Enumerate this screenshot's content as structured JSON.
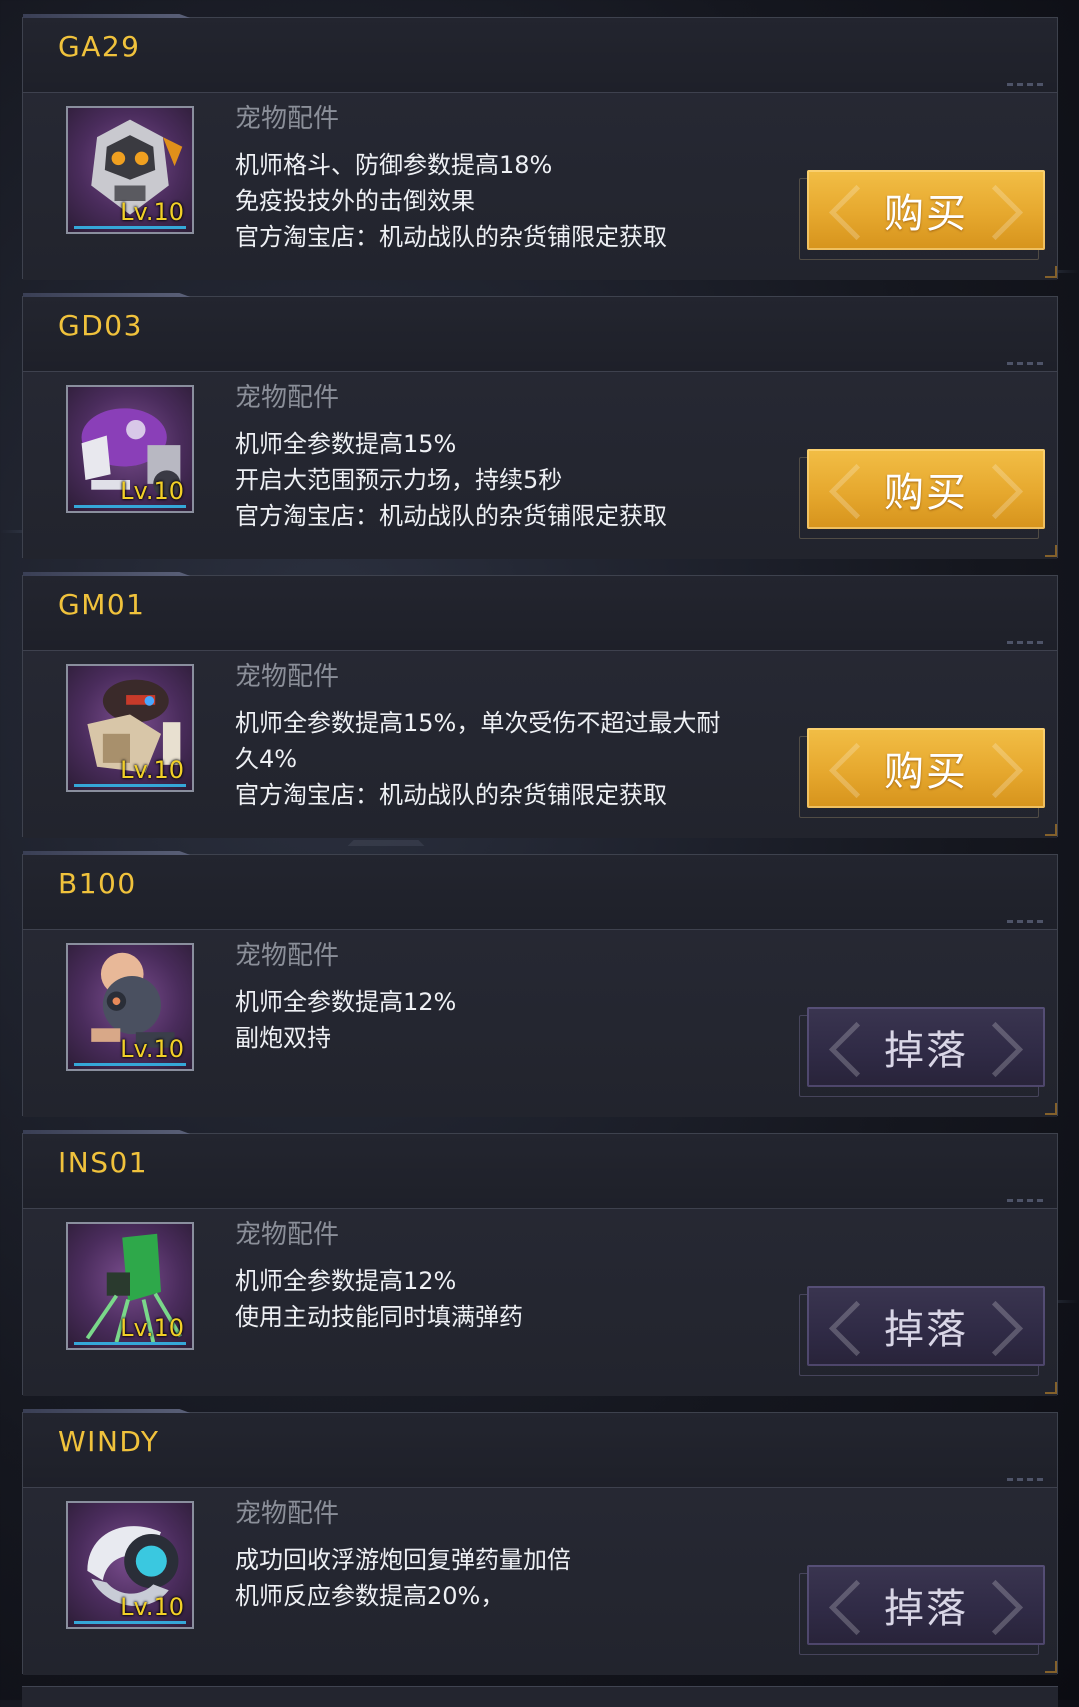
{
  "colors": {
    "code_text": "#f0c23c",
    "level_text": "#f2d028",
    "buy_button": "#e6a82e",
    "drop_button": "#2f2a45"
  },
  "items": [
    {
      "code": "GA29",
      "category": "宠物配件",
      "level": "Lv.10",
      "description": [
        "机师格斗、防御参数提高18%",
        "免疫投技外的击倒效果",
        "官方淘宝店：机动战队的杂货铺限定获取"
      ],
      "action": {
        "type": "buy",
        "label": "购买"
      },
      "icon": "gorilla-mech-icon"
    },
    {
      "code": "GD03",
      "category": "宠物配件",
      "level": "Lv.10",
      "description": [
        "机师全参数提高15%",
        "开启大范围预示力场，持续5秒",
        "官方淘宝店：机动战队的杂货铺限定获取"
      ],
      "action": {
        "type": "buy",
        "label": "购买"
      },
      "icon": "purple-dino-mech-icon"
    },
    {
      "code": "GM01",
      "category": "宠物配件",
      "level": "Lv.10",
      "description": [
        "机师全参数提高15%，单次受伤不超过最大耐",
        "久4%",
        "官方淘宝店：机动战队的杂货铺限定获取"
      ],
      "action": {
        "type": "buy",
        "label": "购买"
      },
      "icon": "monkey-mech-icon"
    },
    {
      "code": "B100",
      "category": "宠物配件",
      "level": "Lv.10",
      "description": [
        "机师全参数提高12%",
        "副炮双持"
      ],
      "action": {
        "type": "drop",
        "label": "掉落"
      },
      "icon": "round-drone-icon"
    },
    {
      "code": "INS01",
      "category": "宠物配件",
      "level": "Lv.10",
      "description": [
        "机师全参数提高12%",
        "使用主动技能同时填满弹药"
      ],
      "action": {
        "type": "drop",
        "label": "掉落"
      },
      "icon": "green-spider-mech-icon"
    },
    {
      "code": "WINDY",
      "category": "宠物配件",
      "level": "Lv.10",
      "description": [
        "成功回收浮游炮回复弹药量加倍",
        "机师反应参数提高20%，"
      ],
      "action": {
        "type": "drop",
        "label": "掉落"
      },
      "icon": "white-pod-mech-icon"
    }
  ]
}
